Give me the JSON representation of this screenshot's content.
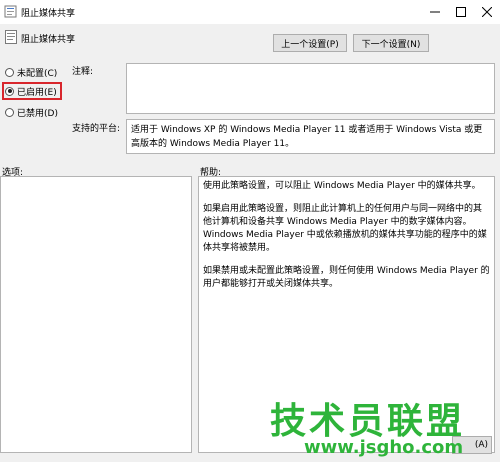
{
  "window": {
    "title": "阻止媒体共享"
  },
  "header": {
    "title": "阻止媒体共享",
    "prev_label": "上一个设置(P)",
    "next_label": "下一个设置(N)"
  },
  "options": {
    "not_configured": "未配置(C)",
    "enabled": "已启用(E)",
    "disabled": "已禁用(D)",
    "selected": "enabled"
  },
  "comment": {
    "label": "注释:",
    "value": ""
  },
  "platform": {
    "label": "支持的平台:",
    "value": "适用于 Windows XP 的 Windows Media Player 11 或者适用于 Windows Vista 或更高版本的 Windows Media Player 11。"
  },
  "sections": {
    "options_label": "选项:",
    "help_label": "帮助:"
  },
  "help": {
    "p1": "使用此策略设置，可以阻止 Windows Media Player 中的媒体共享。",
    "p2": "如果启用此策略设置，则阻止此计算机上的任何用户与同一网络中的其他计算机和设备共享 Windows Media Player 中的数字媒体内容。Windows Media Player 中或依赖播放机的媒体共享功能的程序中的媒体共享将被禁用。",
    "p3": "如果禁用或未配置此策略设置，则任何使用 Windows Media Player 的用户都能够打开或关闭媒体共享。"
  },
  "watermark": {
    "text": "技术员联盟",
    "url": "www.jsgho.com"
  },
  "footer": {
    "partial_button": "(A)"
  },
  "colors": {
    "highlight": "#d8262c",
    "watermark": "#2eb43a"
  }
}
